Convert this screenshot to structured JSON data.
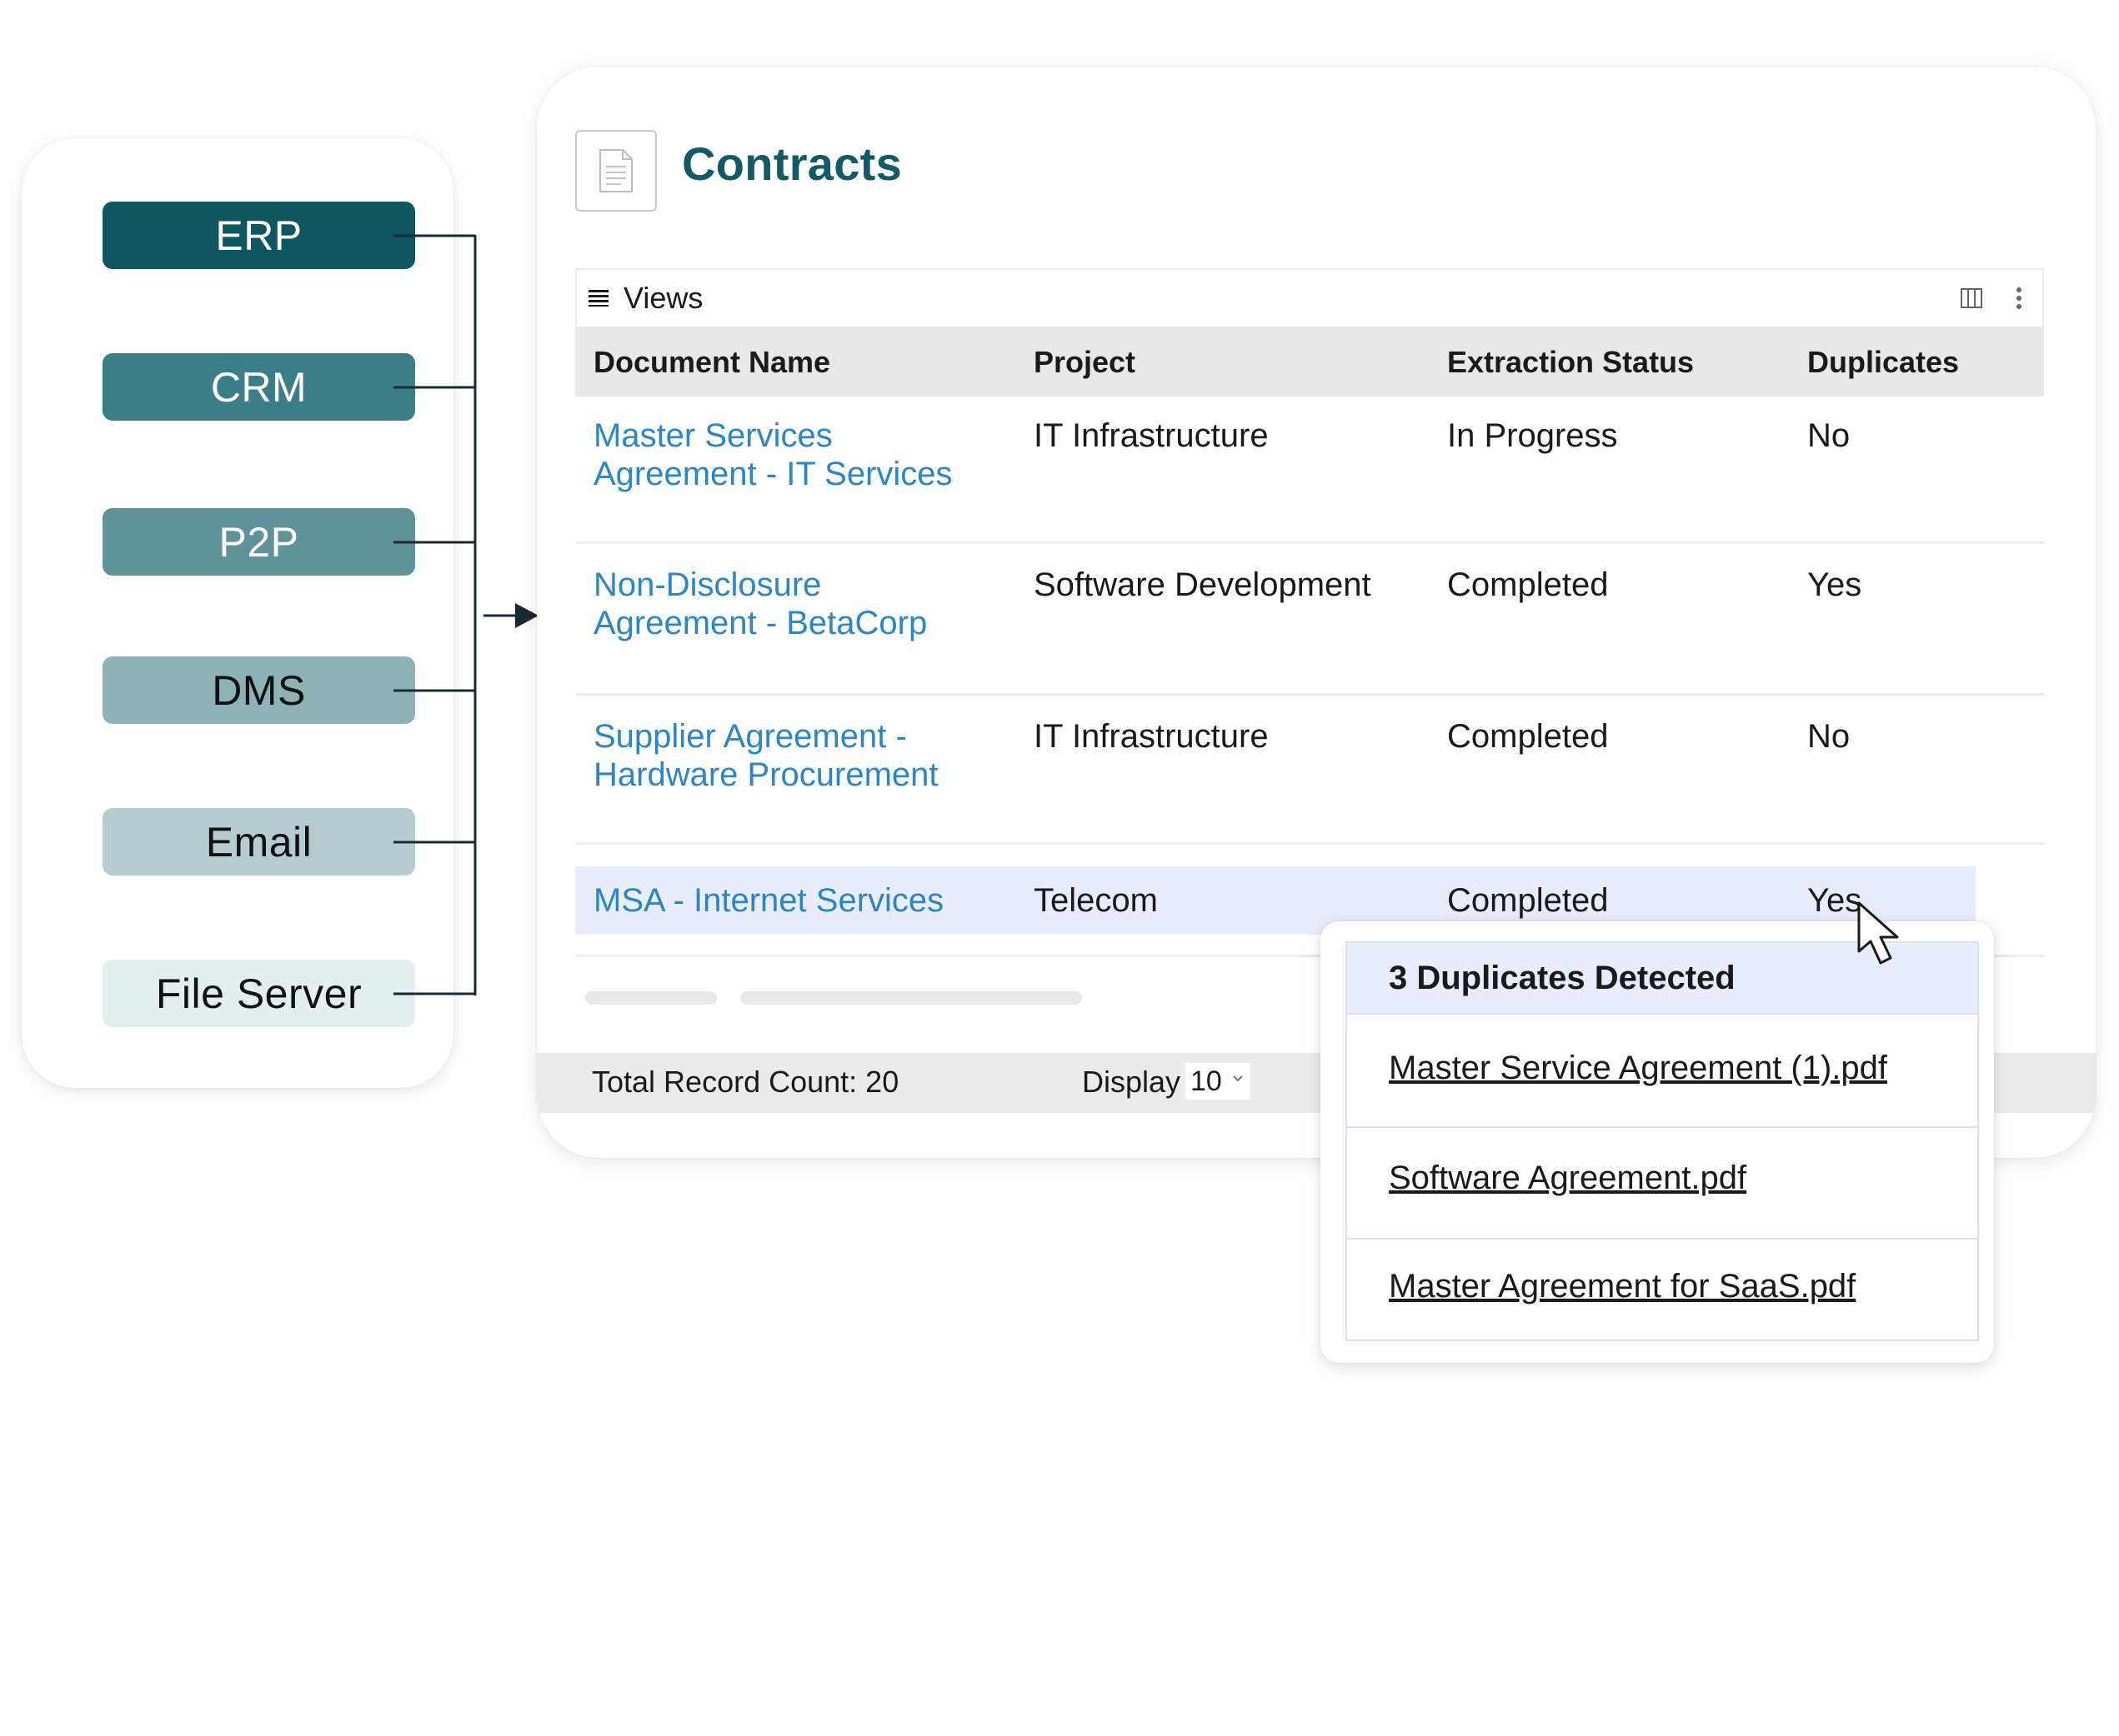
{
  "sources": [
    {
      "label": "ERP",
      "bg": "#0f5661",
      "color": "#ffffff"
    },
    {
      "label": "CRM",
      "bg": "#3c7e86",
      "color": "#ffffff"
    },
    {
      "label": "P2P",
      "bg": "#5f9399",
      "color": "#ffffff"
    },
    {
      "label": "DMS",
      "bg": "#8db3b7",
      "color": "#111111"
    },
    {
      "label": "Email",
      "bg": "#b5cdd0",
      "color": "#111111"
    },
    {
      "label": "File Server",
      "bg": "#e5eeef",
      "color": "#111111"
    }
  ],
  "page": {
    "title": "Contracts",
    "title_color": "#135a67",
    "icon": "document-icon"
  },
  "toolbar": {
    "views_label": "Views",
    "menu_icon": "list-icon",
    "columns_icon": "columns-icon",
    "more_icon": "kebab-menu-icon"
  },
  "table": {
    "columns": [
      "Document Name",
      "Project",
      "Extraction Status",
      "Duplicates"
    ],
    "rows": [
      {
        "doc_line1": "Master Services",
        "doc_line2": "Agreement - IT  Services",
        "project": "IT Infrastructure",
        "status": "In Progress",
        "duplicates": "No"
      },
      {
        "doc_line1": "Non-Disclosure",
        "doc_line2": "Agreement - BetaCorp",
        "project": "Software Development",
        "status": "Completed",
        "duplicates": "Yes"
      },
      {
        "doc_line1": "Supplier Agreement -",
        "doc_line2": "Hardware Procurement",
        "project": "IT Infrastructure",
        "status": "Completed",
        "duplicates": "No"
      },
      {
        "doc_line1": "MSA - Internet Services",
        "doc_line2": "",
        "project": "Telecom",
        "status": "Completed",
        "duplicates": "Yes"
      }
    ],
    "link_color": "#2a86c6",
    "highlight_color": "#e9ecfb"
  },
  "footer": {
    "total_label": "Total Record Count: 20",
    "display_label": "Display",
    "display_value": "10"
  },
  "popup": {
    "title": "3 Duplicates Detected",
    "files": [
      "Master Service Agreement (1).pdf",
      "Software Agreement.pdf",
      "Master Agreement for SaaS.pdf"
    ]
  }
}
